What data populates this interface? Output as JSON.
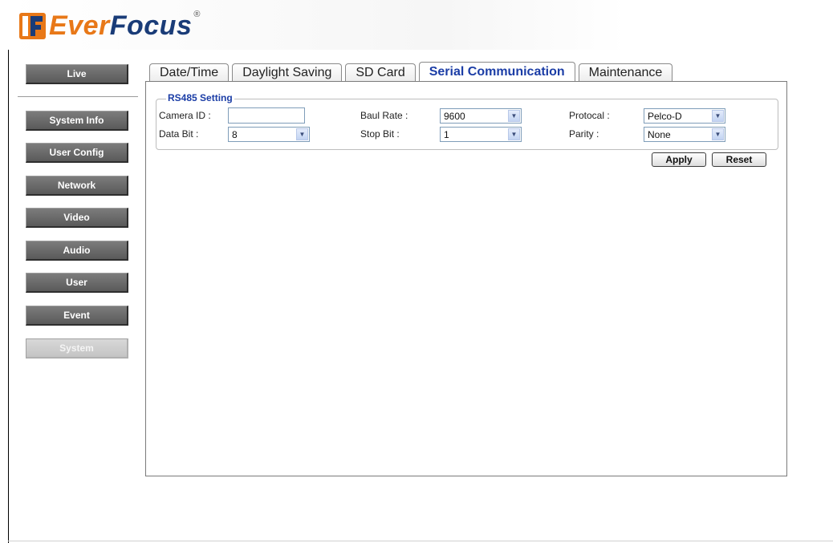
{
  "brand": {
    "ever": "Ever",
    "focus": "Focus",
    "reg": "®"
  },
  "sidebar": {
    "items": [
      {
        "label": "Live"
      },
      {
        "label": "System Info"
      },
      {
        "label": "User Config"
      },
      {
        "label": "Network"
      },
      {
        "label": "Video"
      },
      {
        "label": "Audio"
      },
      {
        "label": "User"
      },
      {
        "label": "Event"
      },
      {
        "label": "System"
      }
    ]
  },
  "tabs": [
    {
      "label": "Date/Time"
    },
    {
      "label": "Daylight Saving"
    },
    {
      "label": "SD Card"
    },
    {
      "label": "Serial Communication"
    },
    {
      "label": "Maintenance"
    }
  ],
  "rs485": {
    "legend": "RS485 Setting",
    "camera_id": {
      "label": "Camera ID :",
      "value": ""
    },
    "baud_rate": {
      "label": "Baul Rate :",
      "value": "9600"
    },
    "protocol": {
      "label": "Protocal :",
      "value": "Pelco-D"
    },
    "data_bit": {
      "label": "Data Bit :",
      "value": "8"
    },
    "stop_bit": {
      "label": "Stop Bit :",
      "value": "1"
    },
    "parity": {
      "label": "Parity :",
      "value": "None"
    }
  },
  "actions": {
    "apply": "Apply",
    "reset": "Reset"
  },
  "colors": {
    "accent": "#1b3da6",
    "logo_orange": "#e87818",
    "logo_blue": "#1a3c78",
    "nav_bg": "#6a6a6a"
  },
  "icons": {
    "dropdown": "chevron-down-icon",
    "logo": "everfocus-logo-icon"
  }
}
